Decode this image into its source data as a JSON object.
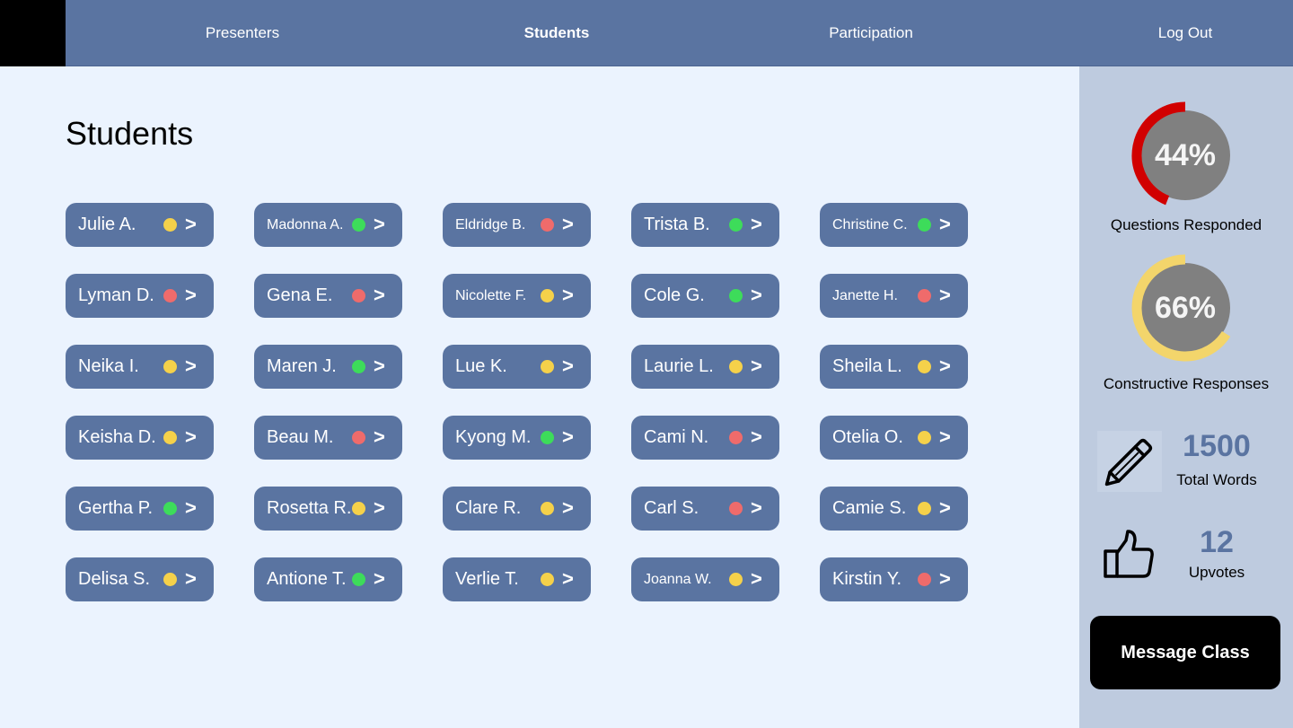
{
  "nav": {
    "items": [
      {
        "label": "Presenters",
        "active": false
      },
      {
        "label": "Students",
        "active": true
      },
      {
        "label": "Participation",
        "active": false
      },
      {
        "label": "Log Out",
        "active": false
      }
    ]
  },
  "main": {
    "title": "Students",
    "status_colors": {
      "yellow": "#f5d14a",
      "red": "#ef6b6b",
      "green": "#3ddc5a"
    },
    "students": [
      {
        "name": "Julie A.",
        "status": "yellow"
      },
      {
        "name": "Madonna A.",
        "status": "green",
        "small": true
      },
      {
        "name": "Eldridge B.",
        "status": "red",
        "small": true
      },
      {
        "name": "Trista B.",
        "status": "green"
      },
      {
        "name": "Christine C.",
        "status": "green",
        "small": true
      },
      {
        "name": "Lyman D.",
        "status": "red"
      },
      {
        "name": "Gena E.",
        "status": "red"
      },
      {
        "name": "Nicolette F.",
        "status": "yellow",
        "small": true
      },
      {
        "name": "Cole G.",
        "status": "green"
      },
      {
        "name": "Janette H.",
        "status": "red",
        "small": true
      },
      {
        "name": "Neika I.",
        "status": "yellow"
      },
      {
        "name": "Maren J.",
        "status": "green"
      },
      {
        "name": "Lue K.",
        "status": "yellow"
      },
      {
        "name": "Laurie L.",
        "status": "yellow"
      },
      {
        "name": "Sheila L.",
        "status": "yellow"
      },
      {
        "name": "Keisha D.",
        "status": "yellow"
      },
      {
        "name": "Beau M.",
        "status": "red"
      },
      {
        "name": "Kyong M.",
        "status": "green"
      },
      {
        "name": "Cami N.",
        "status": "red"
      },
      {
        "name": "Otelia O.",
        "status": "yellow"
      },
      {
        "name": "Gertha P.",
        "status": "green"
      },
      {
        "name": "Rosetta R.",
        "status": "yellow"
      },
      {
        "name": "Clare R.",
        "status": "yellow"
      },
      {
        "name": "Carl S.",
        "status": "red"
      },
      {
        "name": "Camie S.",
        "status": "yellow"
      },
      {
        "name": "Delisa S.",
        "status": "yellow"
      },
      {
        "name": "Antione T.",
        "status": "green"
      },
      {
        "name": "Verlie T.",
        "status": "yellow"
      },
      {
        "name": "Joanna W.",
        "status": "yellow",
        "small": true
      },
      {
        "name": "Kirstin Y.",
        "status": "red"
      }
    ],
    "chevron": ">"
  },
  "sidebar": {
    "questions": {
      "percent_label": "44%",
      "value": 0.44,
      "caption": "Questions Responded",
      "color": "#d10000"
    },
    "constructive": {
      "percent_label": "66%",
      "value": 0.66,
      "caption": "Constructive Responses",
      "color": "#f3d56b"
    },
    "words": {
      "value": "1500",
      "label": "Total Words",
      "icon": "pencil-icon"
    },
    "upvotes": {
      "value": "12",
      "label": "Upvotes",
      "icon": "thumbs-up-icon"
    },
    "message_button": "Message Class"
  }
}
